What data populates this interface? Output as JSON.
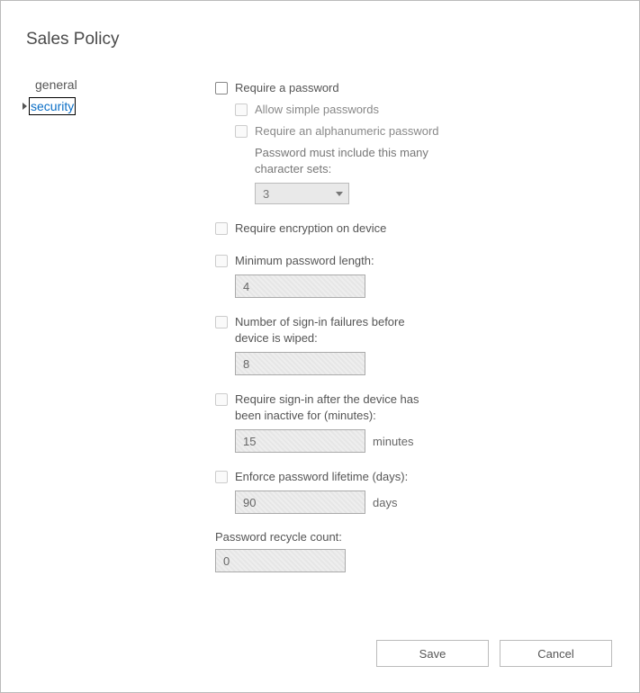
{
  "page_title": "Sales Policy",
  "sidebar": {
    "items": [
      {
        "label": "general"
      },
      {
        "label": "security"
      }
    ]
  },
  "security": {
    "require_password_label": "Require a password",
    "allow_simple_label": "Allow simple passwords",
    "require_alnum_label": "Require an alphanumeric password",
    "charset_label": "Password must include this many character sets:",
    "charset_value": "3",
    "require_encryption_label": "Require encryption on device",
    "min_pwd_len_label": "Minimum password length:",
    "min_pwd_len_value": "4",
    "signin_failures_label": "Number of sign-in failures before device is wiped:",
    "signin_failures_value": "8",
    "inactive_label": "Require sign-in after the device has been inactive for (minutes):",
    "inactive_value": "15",
    "inactive_unit": "minutes",
    "enforce_lifetime_label": "Enforce password lifetime (days):",
    "enforce_lifetime_value": "90",
    "enforce_lifetime_unit": "days",
    "recycle_label": "Password recycle count:",
    "recycle_value": "0"
  },
  "buttons": {
    "save": "Save",
    "cancel": "Cancel"
  }
}
